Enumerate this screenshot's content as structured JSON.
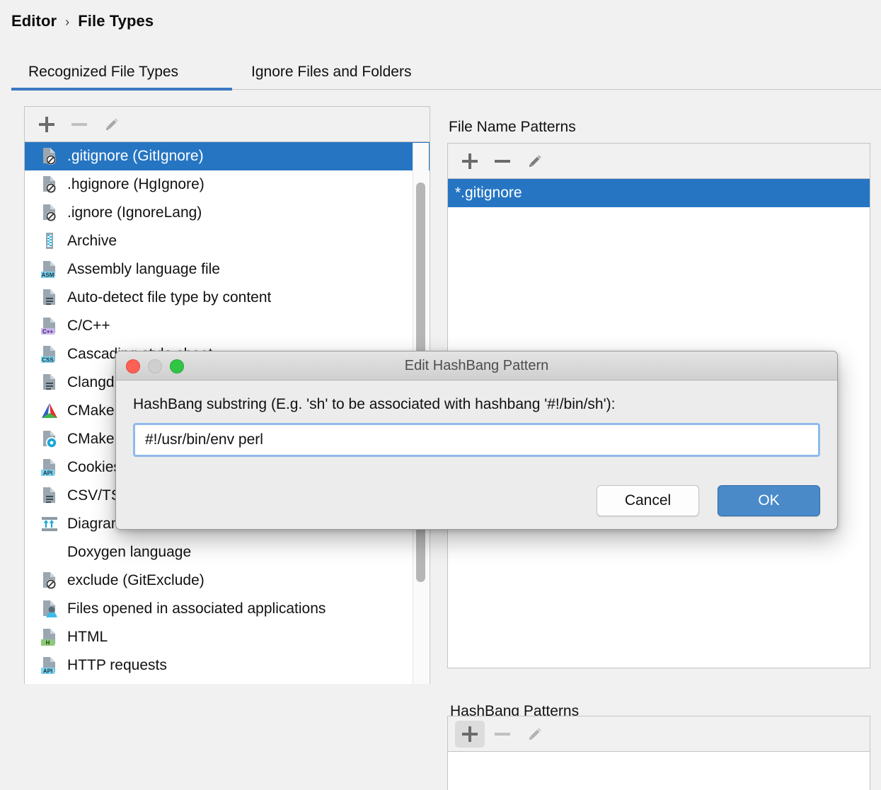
{
  "breadcrumb": {
    "parent": "Editor",
    "separator": "›",
    "current": "File Types"
  },
  "tabs": [
    {
      "label": "Recognized File Types",
      "selected": true
    },
    {
      "label": "Ignore Files and Folders",
      "selected": false
    }
  ],
  "left_toolbar": {
    "add": "add-icon",
    "remove": "remove-icon",
    "edit": "edit-icon"
  },
  "file_types": [
    {
      "label": ".gitignore (GitIgnore)",
      "icon": "file-ignore-icon",
      "selected": true
    },
    {
      "label": ".hgignore (HgIgnore)",
      "icon": "file-ignore-icon",
      "selected": false
    },
    {
      "label": ".ignore (IgnoreLang)",
      "icon": "file-ignore-icon",
      "selected": false
    },
    {
      "label": "Archive",
      "icon": "archive-icon",
      "selected": false
    },
    {
      "label": "Assembly language file",
      "icon": "file-asm-icon",
      "selected": false
    },
    {
      "label": "Auto-detect file type by content",
      "icon": "file-text-icon",
      "selected": false
    },
    {
      "label": "C/C++",
      "icon": "file-cpp-icon",
      "selected": false
    },
    {
      "label": "Cascading style sheet",
      "icon": "file-css-icon",
      "selected": false
    },
    {
      "label": "Clangd config",
      "icon": "file-text-icon",
      "selected": false
    },
    {
      "label": "CMake",
      "icon": "cmake-icon",
      "selected": false
    },
    {
      "label": "CMake cache",
      "icon": "file-gear-icon",
      "selected": false
    },
    {
      "label": "Cookies",
      "icon": "file-api-icon",
      "selected": false
    },
    {
      "label": "CSV/TSV",
      "icon": "file-text-icon",
      "selected": false
    },
    {
      "label": "Diagram",
      "icon": "diagram-icon",
      "selected": false
    },
    {
      "label": "Doxygen language",
      "icon": "none",
      "selected": false
    },
    {
      "label": "exclude (GitExclude)",
      "icon": "file-ignore-icon",
      "selected": false
    },
    {
      "label": "Files opened in associated applications",
      "icon": "file-user-icon",
      "selected": false
    },
    {
      "label": "HTML",
      "icon": "file-html-icon",
      "selected": false
    },
    {
      "label": "HTTP requests",
      "icon": "file-api-icon",
      "selected": false
    }
  ],
  "file_name_patterns": {
    "title": "File Name Patterns",
    "toolbar": {
      "add": "add-icon",
      "remove": "remove-icon",
      "edit": "edit-icon"
    },
    "items": [
      {
        "label": "*.gitignore",
        "selected": true
      }
    ]
  },
  "hashbang_patterns": {
    "title": "HashBang Patterns",
    "toolbar": {
      "add": "add-icon",
      "remove": "remove-icon",
      "edit": "edit-icon"
    },
    "items": []
  },
  "dialog": {
    "title": "Edit HashBang Pattern",
    "prompt": "HashBang substring (E.g. 'sh' to be associated with hashbang '#!/bin/sh'):",
    "input_value": "#!/usr/bin/env perl",
    "input_placeholder": "",
    "cancel_label": "Cancel",
    "ok_label": "OK"
  },
  "colors": {
    "selection_blue": "#2675c2",
    "tab_underline": "#3b78c3",
    "ok_button": "#4a8ac9",
    "focus_ring": "#8fbaea",
    "window_bg": "#f1f1f1"
  }
}
